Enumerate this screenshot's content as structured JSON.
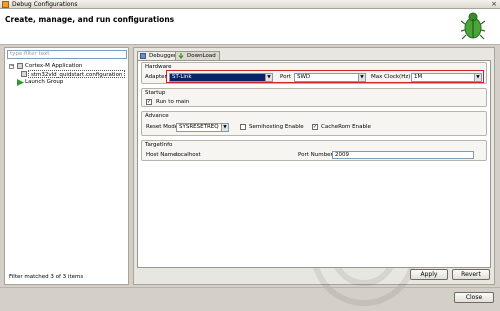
{
  "window": {
    "title": "Debug Configurations"
  },
  "header": {
    "title": "Create, manage, and run configurations",
    "subtitle": ""
  },
  "left": {
    "filter_placeholder": "type filter text",
    "tree": {
      "group_label": "Cortex-M Application",
      "child_label": "stm32vld_quidstart.configuration",
      "launch_label": "Launch Group"
    },
    "status": "Filter matched 3 of 3 items"
  },
  "tabs": [
    {
      "label": "Debugger"
    },
    {
      "label": "DownLoad"
    }
  ],
  "hardware": {
    "group_label": "Hardware",
    "adapter_label": "Adapter",
    "adapter_value": "ST-Link",
    "port_label": "Port",
    "port_value": "SWD",
    "clock_label": "Max Clock(Hz)",
    "clock_value": "1M"
  },
  "startup": {
    "group_label": "Startup",
    "run_to_main_label": "Run to main",
    "run_to_main_checked": true
  },
  "advance": {
    "group_label": "Advance",
    "reset_mode_label": "Reset Mode",
    "reset_mode_value": "SYSRESETREQ",
    "semihosting_label": "Semihosting Enable",
    "semihosting_checked": false,
    "cacherom_label": "CacheRom Enable",
    "cacherom_checked": true
  },
  "target": {
    "group_label": "TargetInfo",
    "host_label": "Host Name:",
    "host_value": "localhost",
    "port_label": "Port Number:",
    "port_value": "2009"
  },
  "buttons": {
    "apply": "Apply",
    "revert": "Revert",
    "close": "Close"
  },
  "colors": {
    "highlight": "#d0242a",
    "selection": "#0a246a"
  }
}
